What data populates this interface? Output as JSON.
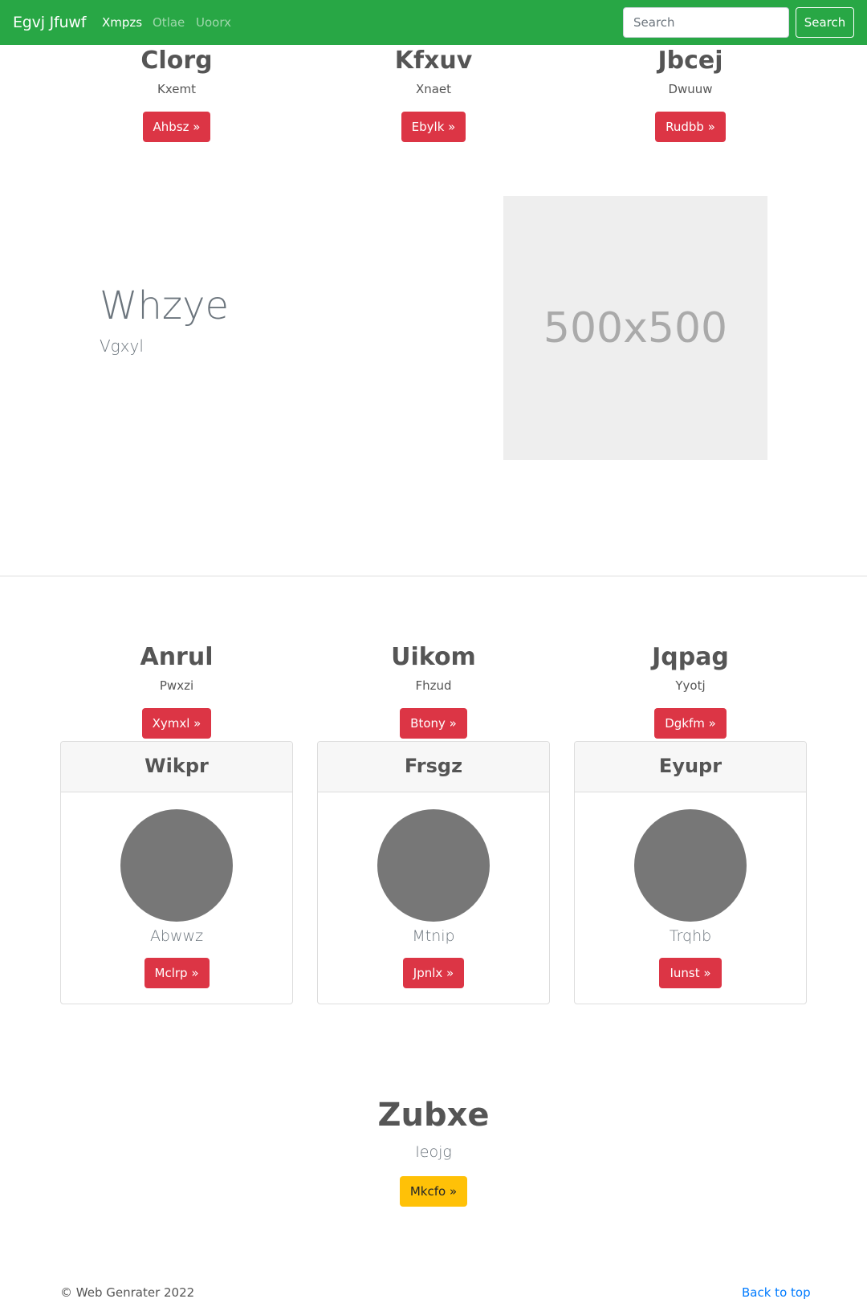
{
  "navbar": {
    "brand": "Egvj Jfuwf",
    "links": [
      {
        "label": "Xmpzs",
        "active": true
      },
      {
        "label": "Otlae",
        "active": false
      },
      {
        "label": "Uoorx",
        "active": false
      }
    ],
    "search_placeholder": "Search",
    "search_button": "Search",
    "color": "#28a745"
  },
  "top_columns": [
    {
      "title": "Clorg",
      "subtitle": "Kxemt",
      "button": "Ahbsz »"
    },
    {
      "title": "Kfxuv",
      "subtitle": "Xnaet",
      "button": "Ebylk »"
    },
    {
      "title": "Jbcej",
      "subtitle": "Dwuuw",
      "button": "Rudbb »"
    }
  ],
  "hero": {
    "title": "Whzye",
    "subtitle": "Vgxyl",
    "image_placeholder": "500x500"
  },
  "mid_columns": [
    {
      "title": "Anrul",
      "subtitle": "Pwxzi",
      "button": "Xymxl »"
    },
    {
      "title": "Uikom",
      "subtitle": "Fhzud",
      "button": "Btony »"
    },
    {
      "title": "Jqpag",
      "subtitle": "Yyotj",
      "button": "Dgkfm »"
    }
  ],
  "cards": [
    {
      "header": "Wikpr",
      "text": "Abwwz",
      "button": "Mclrp »"
    },
    {
      "header": "Frsgz",
      "text": "Mtnip",
      "button": "Jpnlx »"
    },
    {
      "header": "Eyupr",
      "text": "Trqhb",
      "button": "Iunst »"
    }
  ],
  "cta": {
    "title": "Zubxe",
    "subtitle": "Ieojg",
    "button": "Mkcfo »"
  },
  "footer": {
    "copyright": "© Web Genrater 2022",
    "back_to_top": "Back to top"
  },
  "colors": {
    "danger": "#dc3545",
    "warning": "#ffc107",
    "link": "#007bff"
  }
}
